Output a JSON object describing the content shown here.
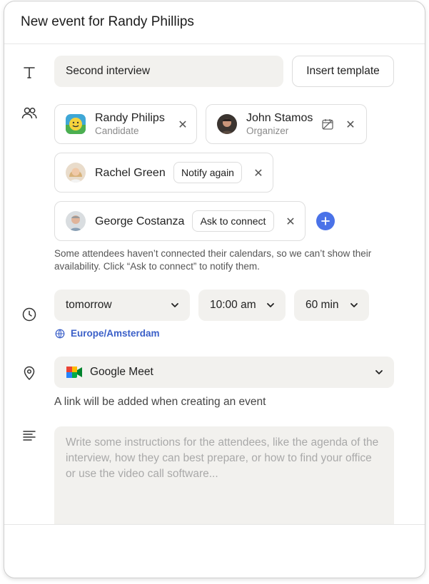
{
  "header": {
    "title": "New event for Randy Phillips"
  },
  "title_row": {
    "value": "Second interview",
    "insert_template_label": "Insert template"
  },
  "attendees": [
    {
      "name": "Randy Philips",
      "role": "Candidate",
      "avatar": "cartoon-face"
    },
    {
      "name": "John Stamos",
      "role": "Organizer",
      "avatar": "photo",
      "extra_icon": "calendar-off-icon"
    },
    {
      "name": "Rachel Green",
      "action_label": "Notify again",
      "avatar": "photo"
    },
    {
      "name": "George Costanza",
      "action_label": "Ask to connect",
      "avatar": "photo"
    }
  ],
  "attendee_note": "Some attendees haven’t connected their calendars, so we can’t show their availability. Click “Ask to connect” to notify them.",
  "schedule": {
    "date": "tomorrow",
    "time": "10:00 am",
    "duration": "60 min",
    "timezone": "Europe/Amsterdam"
  },
  "location": {
    "value": "Google Meet",
    "note": "A link will be added when creating an event"
  },
  "description": {
    "placeholder": "Write some instructions for the attendees, like the agenda of the interview, how they can best prepare, or how to find your office or use the video call software..."
  },
  "colors": {
    "accent_blue": "#4a72e8",
    "link_blue": "#3a5fc8",
    "field_bg": "#f2f1ee"
  }
}
